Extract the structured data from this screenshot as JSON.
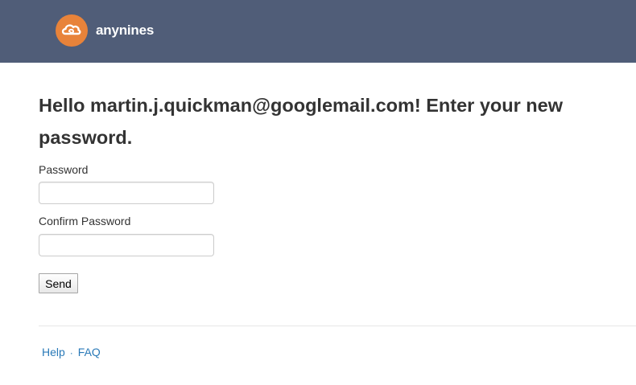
{
  "header": {
    "brand": "anynines",
    "logo_icon": "cloud-icon",
    "background_color": "#505d78",
    "logo_color": "#e8833a"
  },
  "main": {
    "heading": "Hello martin.j.quickman@googlemail.com! Enter your new password.",
    "password_label": "Password",
    "password_value": "",
    "confirm_label": "Confirm Password",
    "confirm_value": "",
    "submit_label": "Send"
  },
  "footer": {
    "links": [
      "Help",
      "FAQ"
    ],
    "separator": "·",
    "link_color": "#2a7ab8"
  }
}
